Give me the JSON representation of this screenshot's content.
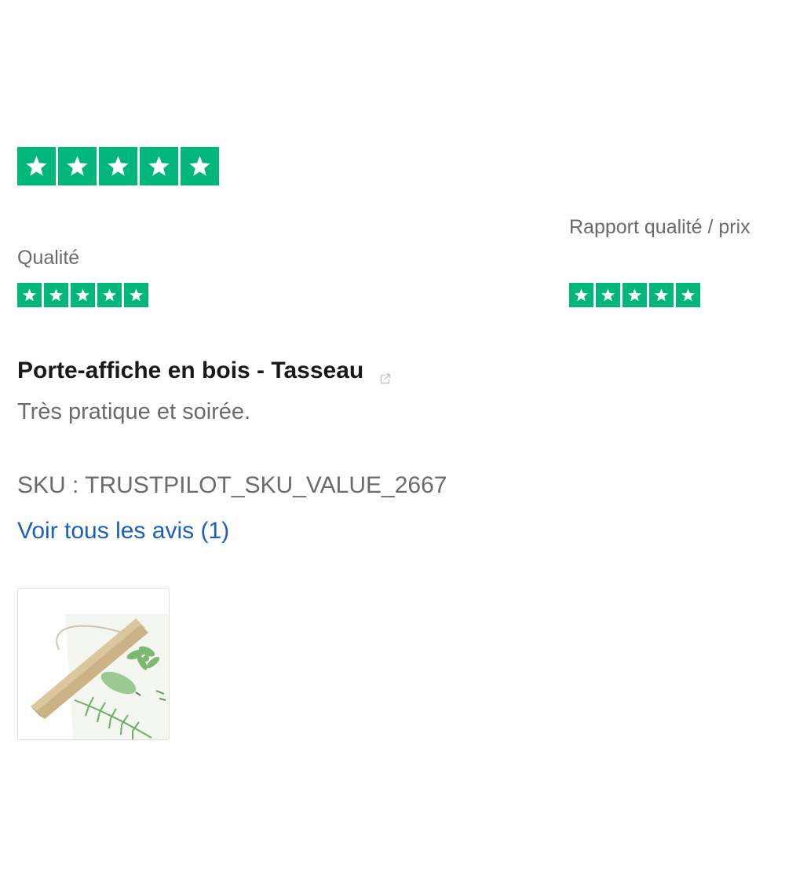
{
  "review": {
    "overall_rating": 5,
    "sub_ratings": [
      {
        "label": "Qualité",
        "rating": 5
      },
      {
        "label": "Rapport qualité / prix",
        "rating": 5
      }
    ],
    "product_title": "Porte-affiche en bois - Tasseau",
    "text": "Très pratique et soirée.",
    "sku": "SKU : TRUSTPILOT_SKU_VALUE_2667",
    "see_all_label": "Voir tous les avis (1)"
  },
  "colors": {
    "star_green": "#00b67a",
    "link_blue": "#1c5fc1"
  },
  "icons": {
    "star": "star-icon",
    "external": "external-link-icon"
  }
}
